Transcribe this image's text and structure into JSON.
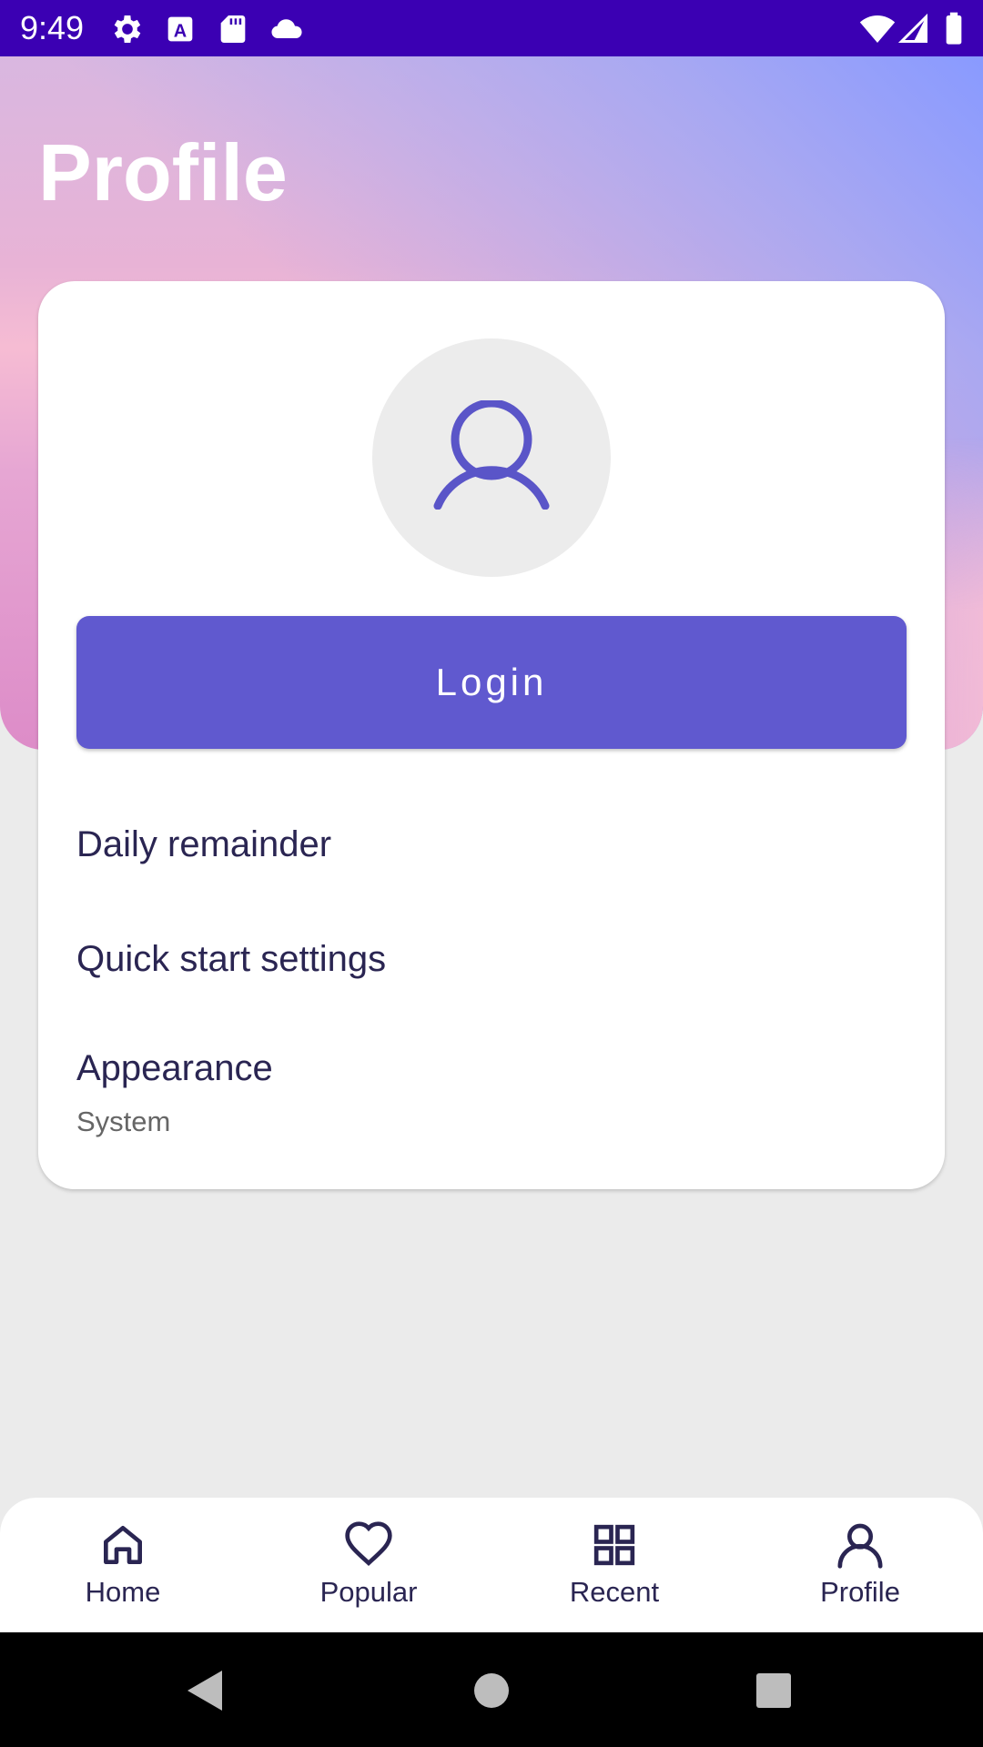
{
  "status_bar": {
    "time": "9:49",
    "left_icons": [
      "gear-icon",
      "font-a-icon",
      "sd-card-icon",
      "cloud-icon"
    ],
    "right_icons": [
      "wifi-icon",
      "signal-icon",
      "battery-icon"
    ]
  },
  "header": {
    "title": "Profile"
  },
  "card": {
    "avatar_icon": "person-icon",
    "login_label": "Login",
    "menu": [
      {
        "label": "Daily remainder"
      },
      {
        "label": "Quick start settings"
      },
      {
        "label": "Appearance",
        "subtitle": "System"
      }
    ]
  },
  "bottom_nav": {
    "items": [
      {
        "label": "Home",
        "icon": "home-icon"
      },
      {
        "label": "Popular",
        "icon": "heart-icon"
      },
      {
        "label": "Recent",
        "icon": "grid-icon"
      },
      {
        "label": "Profile",
        "icon": "person-icon",
        "selected": true
      }
    ]
  },
  "system_nav": [
    "back-icon",
    "home-circle-icon",
    "recents-square-icon"
  ],
  "colors": {
    "status_bar": "#3b00b3",
    "accent": "#6059cf",
    "text": "#2a2552",
    "background": "#ebebeb"
  }
}
